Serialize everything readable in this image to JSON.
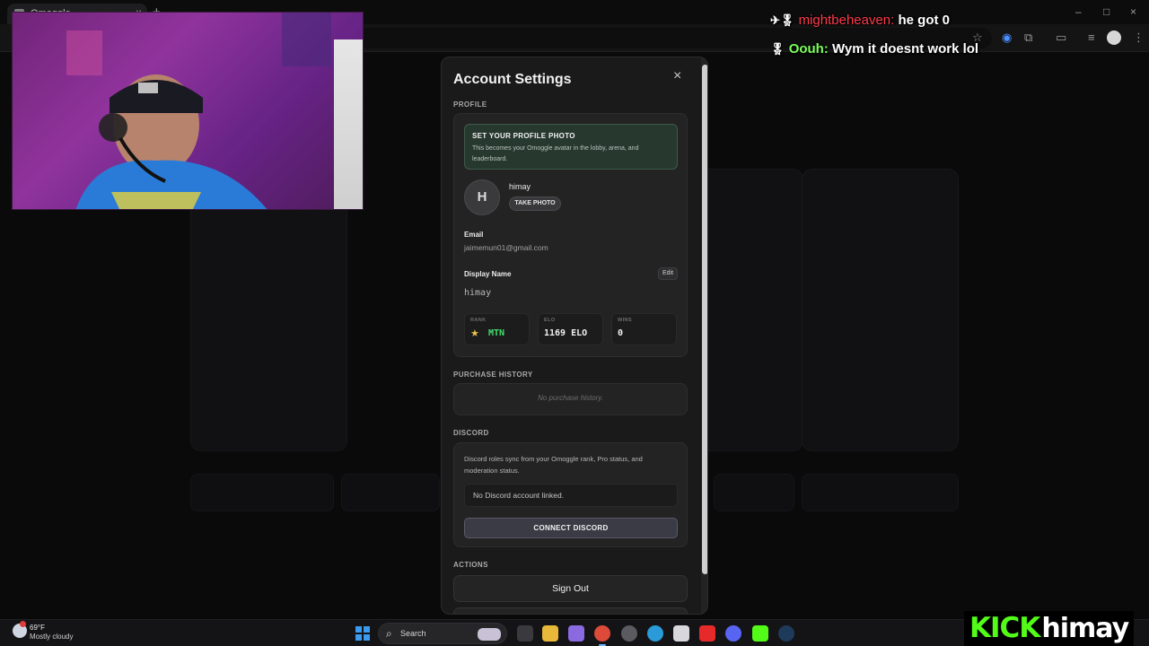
{
  "browser": {
    "tab_title": "Omoggle",
    "tab_close": "×",
    "new_tab": "+",
    "window_controls": {
      "minimize": "–",
      "maximize": "□",
      "close": "×"
    },
    "toolbar_icons": [
      "star-icon",
      "speaker-icon",
      "extensions-icon",
      "split-view-icon",
      "media-icon",
      "profile-icon",
      "menu-icon"
    ]
  },
  "chat": {
    "messages": [
      {
        "user": "mightbeheaven:",
        "text": "he got 0",
        "user_color": "#ff3b4a"
      },
      {
        "user": "Oouh:",
        "text": "Wym it doesnt work lol",
        "user_color": "#7cff5a"
      }
    ],
    "badges": {
      "first": "✈🎖",
      "second": "🎖"
    }
  },
  "modal": {
    "title": "Account Settings",
    "close": "×",
    "profile": {
      "section_label": "PROFILE",
      "banner_title": "SET YOUR PROFILE PHOTO",
      "banner_text": "This becomes your Omoggle avatar in the lobby, arena, and leaderboard.",
      "avatar_initial": "H",
      "username": "himay",
      "take_photo": "TAKE PHOTO",
      "email_label": "Email",
      "email_value": "jaimemun01@gmail.com",
      "display_name_label": "Display Name",
      "display_name_value": "himay",
      "edit_label": "Edit",
      "stats": {
        "rank_label": "RANK",
        "rank_value": "MTN",
        "elo_label": "ELO",
        "elo_value": "1169 ELO",
        "wins_label": "WINS",
        "wins_value": "0"
      }
    },
    "purchase_history": {
      "section_label": "PURCHASE HISTORY",
      "empty": "No purchase history."
    },
    "discord": {
      "section_label": "DISCORD",
      "description": "Discord roles sync from your Omoggle rank, Pro status, and moderation status.",
      "status": "No Discord account linked.",
      "connect": "CONNECT DISCORD"
    },
    "actions": {
      "section_label": "ACTIONS",
      "sign_out": "Sign Out"
    }
  },
  "taskbar": {
    "weather_temp": "69°F",
    "weather_condition": "Mostly cloudy",
    "search_label": "Search",
    "apps": [
      "task-view",
      "file-explorer",
      "copilot",
      "chrome",
      "settings",
      "edge",
      "store",
      "youtube",
      "discord",
      "kick",
      "steam"
    ]
  },
  "overlay": {
    "logo_text": "KICK",
    "channel": "himay"
  },
  "colors": {
    "accent_green": "#53fc18",
    "rank_green": "#43e06e",
    "banner_bg": "#27382f"
  }
}
